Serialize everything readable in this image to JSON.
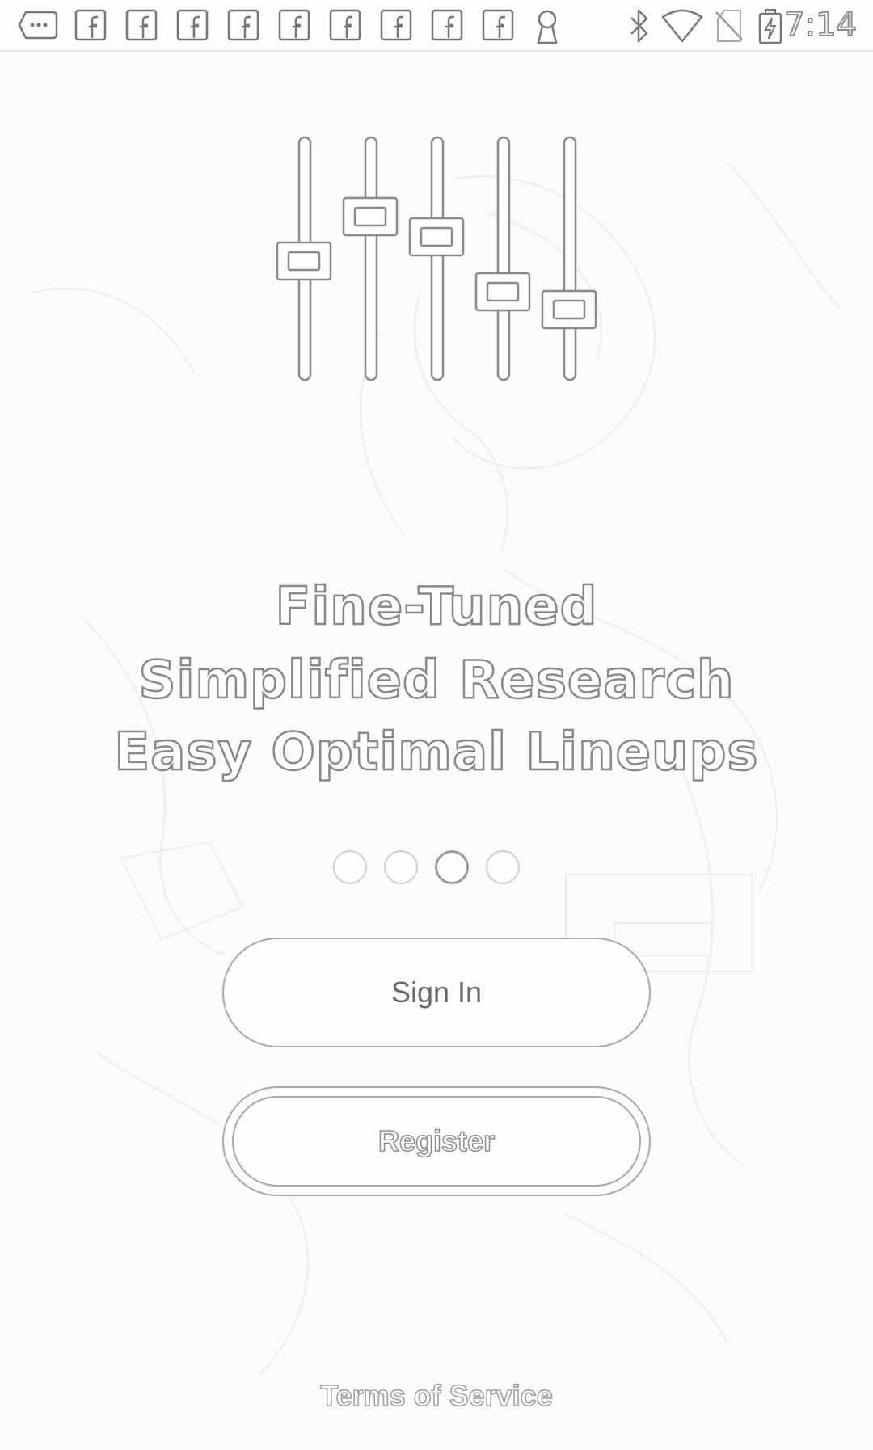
{
  "status_bar": {
    "time": "7:14",
    "left_icons": [
      "more-icon",
      "facebook-icon",
      "facebook-icon",
      "facebook-icon",
      "facebook-icon",
      "facebook-icon",
      "facebook-icon",
      "facebook-icon",
      "facebook-icon",
      "facebook-icon",
      "keyhole-icon"
    ],
    "right_icons": [
      "bluetooth-icon",
      "wifi-icon",
      "no-sim-icon",
      "battery-charging-icon"
    ]
  },
  "hero": {
    "icon": "equalizer-sliders-icon",
    "lines": [
      "Fine-Tuned",
      "Simplified Research",
      "Easy Optimal Lineups"
    ]
  },
  "pager": {
    "count": 4,
    "active_index": 2
  },
  "actions": {
    "sign_in_label": "Sign In",
    "register_label": "Register"
  },
  "footer": {
    "terms_label": "Terms of Service"
  },
  "colors": {
    "background": "#fbfbfb",
    "outline": "#8a8a8a",
    "button_border": "#a8a8a8"
  }
}
